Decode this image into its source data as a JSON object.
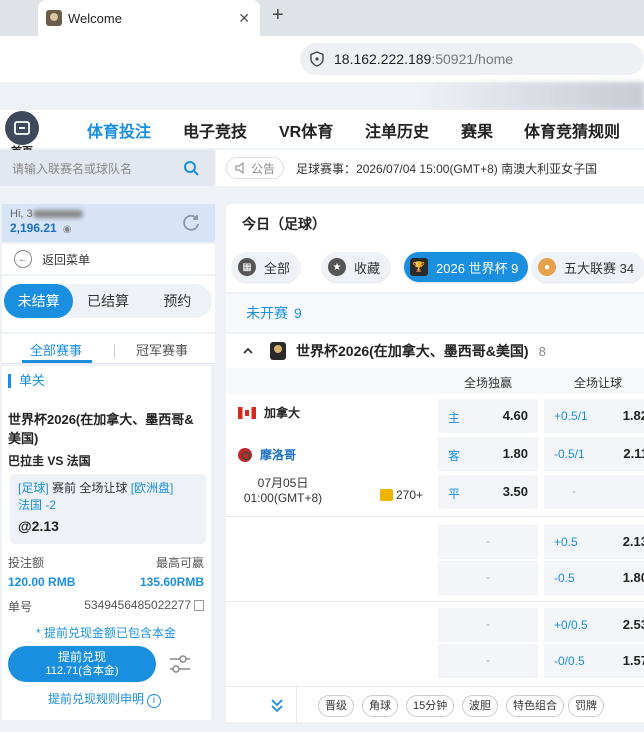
{
  "browser": {
    "tab_title": "Welcome",
    "tab_close": "✕",
    "new_tab": "+",
    "url_host": "18.162.222.189",
    "url_rest": ":50921/home"
  },
  "nav": {
    "home_label": "首页",
    "items": [
      "体育投注",
      "电子竞技",
      "VR体育",
      "注单历史",
      "赛果",
      "体育竞猜规则"
    ],
    "active_index": 0
  },
  "search": {
    "placeholder": "请输入联赛名或球队名"
  },
  "user": {
    "greeting": "Hi, 3",
    "balance": "2,196.21"
  },
  "back_menu": "返回菜单",
  "status_tabs": [
    "未结算",
    "已结算",
    "预约"
  ],
  "sub_tabs": [
    "全部赛事",
    "冠军赛事"
  ],
  "slip": {
    "header": "单关",
    "match": "世界杯2026(在加拿大、墨西哥&美国)",
    "teams": "巴拉圭 VS 法国",
    "bet_tag": "[足球]",
    "bet_desc": "赛前 全场让球",
    "bet_market": "[欧洲盘]",
    "selection": "法国 -2",
    "odds": "@2.13",
    "stake_label": "投注额",
    "max_win_label": "最高可赢",
    "stake_value": "120.00 RMB",
    "max_win_value": "135.60RMB",
    "ticket_label": "单号",
    "ticket_value": "5349456485022277",
    "note": "* 提前兑现金额已包含本金",
    "cashout_line1": "提前兑现",
    "cashout_line2": "112.71(含本金)",
    "rules": "提前兑现规则申明",
    "rules_icon": "i"
  },
  "announcement": {
    "chip": "公告",
    "ticker": "足球赛事：2026/07/04 15:00(GMT+8) 南澳大利亚女子国"
  },
  "today": "今日（足球）",
  "chips": [
    {
      "label": "全部",
      "icon": "grid-icon"
    },
    {
      "label": "收藏",
      "icon": "star-icon"
    },
    {
      "label": "2026 世界杯 9",
      "icon": "worldcup-icon"
    },
    {
      "label": "五大联赛 34",
      "icon": "leagues-icon"
    }
  ],
  "upcoming": {
    "label": "未开赛",
    "count": "9"
  },
  "league": {
    "name": "世界杯2026(在加拿大、墨西哥&美国)",
    "count": "8"
  },
  "columns": [
    "全场独赢",
    "全场让球"
  ],
  "match": {
    "home": "加拿大",
    "away": "摩洛哥",
    "date": "07月05日",
    "time": "01:00(GMT+8)",
    "more": "270+",
    "moneyline": [
      {
        "label": "主",
        "odds": "4.60"
      },
      {
        "label": "客",
        "odds": "1.80"
      },
      {
        "label": "平",
        "odds": "3.50"
      }
    ],
    "handicap": [
      {
        "line": "+0.5/1",
        "odds": "1.82"
      },
      {
        "line": "-0.5/1",
        "odds": "2.11"
      },
      {
        "line": "-",
        "odds": ""
      }
    ],
    "extra_rows": [
      {
        "ml": "-",
        "line": "+0.5",
        "odds": "2.13"
      },
      {
        "ml": "-",
        "line": "-0.5",
        "odds": "1.80"
      },
      {
        "ml": "-",
        "line": "+0/0.5",
        "odds": "2.53"
      },
      {
        "ml": "-",
        "line": "-0/0.5",
        "odds": "1.57"
      }
    ]
  },
  "market_tags": [
    "晋级",
    "角球",
    "15分钟",
    "波胆",
    "特色组合",
    "罚牌"
  ],
  "colors": {
    "accent": "#1a8fe0",
    "panel": "#d6e4f6"
  }
}
